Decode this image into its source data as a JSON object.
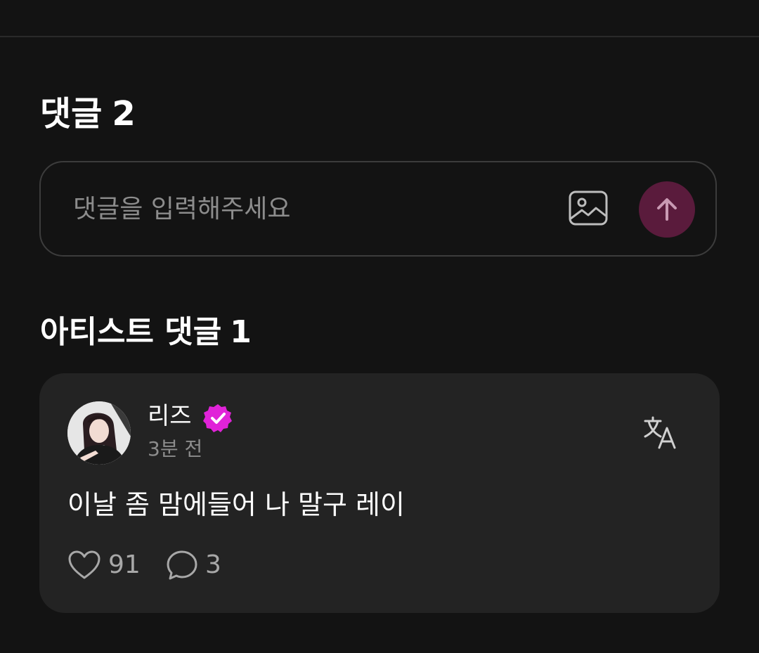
{
  "comments": {
    "heading_label": "댓글",
    "count": "2"
  },
  "comment_input": {
    "placeholder": "댓글을 입력해주세요",
    "value": ""
  },
  "artist_comments": {
    "heading_label": "아티스트 댓글",
    "count": "1"
  },
  "comment": {
    "author": "리즈",
    "time": "3분 전",
    "text": "이날 좀 맘에들어 나 말구 레이",
    "likes": "91",
    "replies": "3"
  },
  "colors": {
    "background": "#131313",
    "card": "#232323",
    "send_button": "#5a1b3c",
    "verified_badge": "#e023d8",
    "muted_text": "#8c8c8c"
  },
  "icons": {
    "image_attach": "image-icon",
    "send": "arrow-up-icon",
    "verified": "verified-badge-icon",
    "translate": "translate-icon",
    "like": "heart-icon",
    "reply": "speech-bubble-icon"
  }
}
